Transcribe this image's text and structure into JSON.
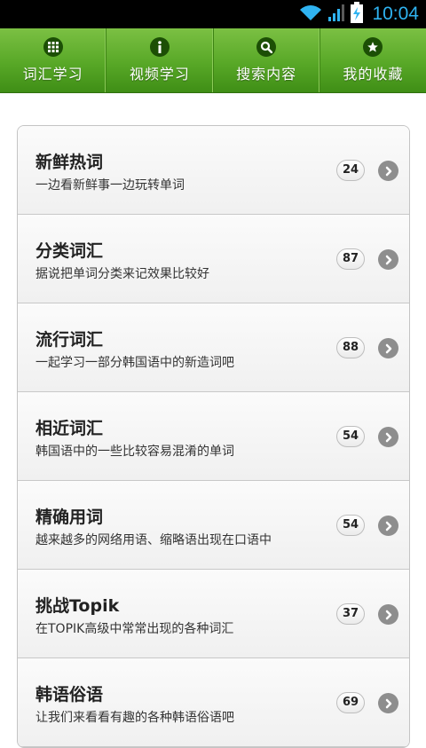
{
  "status_bar": {
    "time": "10:04",
    "icons": [
      "wifi-icon",
      "signal-icon",
      "battery-charging-icon"
    ]
  },
  "nav": {
    "items": [
      {
        "label": "词汇学习",
        "icon": "grid-icon"
      },
      {
        "label": "视频学习",
        "icon": "info-icon"
      },
      {
        "label": "搜索内容",
        "icon": "search-icon"
      },
      {
        "label": "我的收藏",
        "icon": "star-icon"
      }
    ]
  },
  "list": {
    "items": [
      {
        "title": "新鲜热词",
        "subtitle": "一边看新鲜事一边玩转单词",
        "count": "24"
      },
      {
        "title": "分类词汇",
        "subtitle": "据说把单词分类来记效果比较好",
        "count": "87"
      },
      {
        "title": "流行词汇",
        "subtitle": "一起学习一部分韩国语中的新造词吧",
        "count": "88"
      },
      {
        "title": "相近词汇",
        "subtitle": "韩国语中的一些比较容易混淆的单词",
        "count": "54"
      },
      {
        "title": "精确用词",
        "subtitle": "越来越多的网络用语、缩略语出现在口语中",
        "count": "54"
      },
      {
        "title": "挑战Topik",
        "subtitle": "在TOPIK高级中常常出现的各种词汇",
        "count": "37"
      },
      {
        "title": "韩语俗语",
        "subtitle": "让我们来看看有趣的各种韩语俗语吧",
        "count": "69"
      }
    ]
  },
  "colors": {
    "nav_green": "#58a827",
    "time_blue": "#2fb3f1",
    "chevron_gray": "#8e8e8e"
  }
}
